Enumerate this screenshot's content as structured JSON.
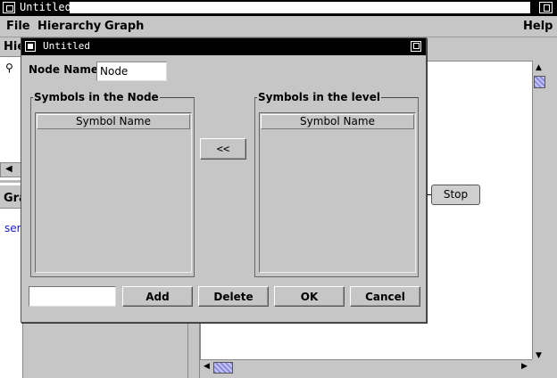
{
  "window": {
    "title": "Untitled"
  },
  "menubar": {
    "file": "File",
    "hierarchy": "Hierarchy",
    "graph": "Graph",
    "help": "Help"
  },
  "left_panes": {
    "top_header": "Hie",
    "top_item_icon": "key-icon",
    "bottom_header": "Gra",
    "bottom_item": "ser"
  },
  "graph": {
    "nodes": [
      {
        "label": "Stop"
      }
    ]
  },
  "dialog": {
    "title": "Untitled",
    "node_name_label": "Node Name",
    "node_name_value": "Node",
    "symbols_in_node": {
      "legend": "Symbols in the Node",
      "column_header": "Symbol Name",
      "rows": []
    },
    "move_button_label": "<<",
    "symbols_in_level": {
      "legend": "Symbols in the level",
      "column_header": "Symbol Name",
      "rows": []
    },
    "symbol_input_value": "",
    "buttons": {
      "add": "Add",
      "delete": "Delete",
      "ok": "OK",
      "cancel": "Cancel"
    }
  },
  "icons": {
    "scroll_up": "▲",
    "scroll_down": "▼",
    "scroll_left": "◀",
    "scroll_right": "▶"
  },
  "colors": {
    "titlebar": "#000000",
    "panel": "#c6c6c6",
    "link_text": "#1a1ac8",
    "scroll_thumb": "#8a8ad8"
  }
}
